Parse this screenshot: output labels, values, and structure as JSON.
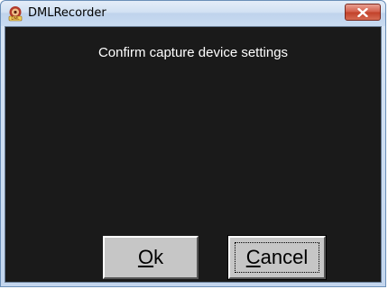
{
  "window": {
    "title": "DMLRecorder",
    "icon": "dmlrecorder-app-icon",
    "close_icon": "close-x-icon"
  },
  "dialog": {
    "prompt": "Confirm capture device settings",
    "ok_accel": "O",
    "ok_rest": "k",
    "cancel_accel": "C",
    "cancel_rest": "ancel"
  },
  "colors": {
    "client_background": "#1a1a1a",
    "button_face": "#c6c6c6",
    "close_button": "#c94a35"
  }
}
